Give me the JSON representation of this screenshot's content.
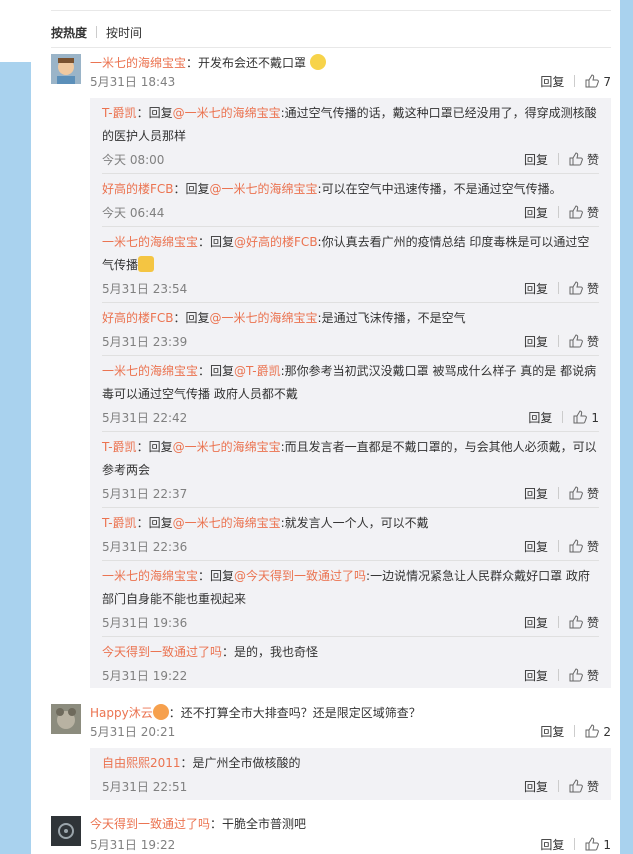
{
  "sort": {
    "hot": "按热度",
    "time": "按时间"
  },
  "labels": {
    "reply": "回复",
    "like": "赞"
  },
  "colors": {
    "link": "#eb7350",
    "accent_bg": "#a9d2ee",
    "reply_bg": "#f2f2f5"
  },
  "comments": [
    {
      "user": "一米七的海绵宝宝",
      "text": "：开发布会还不戴口罩 ",
      "time": "5月31日 18:43",
      "likes": "7",
      "replies": [
        {
          "user": "T-爵凯",
          "pre": "：回复",
          "at": "@一米七的海绵宝宝",
          "text": ":通过空气传播的话，戴这种口罩已经没用了，得穿成测核酸的医护人员那样",
          "time": "今天 08:00",
          "likes": "赞"
        },
        {
          "user": "好高的楼FCB",
          "pre": "：回复",
          "at": "@一米七的海绵宝宝",
          "text": ":可以在空气中迅速传播，不是通过空气传播。",
          "time": "今天 06:44",
          "likes": "赞"
        },
        {
          "user": "一米七的海绵宝宝",
          "pre": "：回复",
          "at": "@好高的楼FCB",
          "text": ":你认真去看广州的疫情总结 印度毒株是可以通过空气传播",
          "time": "5月31日 23:54",
          "likes": "赞"
        },
        {
          "user": "好高的楼FCB",
          "pre": "：回复",
          "at": "@一米七的海绵宝宝",
          "text": ":是通过飞沫传播，不是空气",
          "time": "5月31日 23:39",
          "likes": "赞"
        },
        {
          "user": "一米七的海绵宝宝",
          "pre": "：回复",
          "at": "@T-爵凯",
          "text": ":那你参考当初武汉没戴口罩 被骂成什么样子 真的是 都说病毒可以通过空气传播  政府人员都不戴",
          "time": "5月31日 22:42",
          "likes": "1"
        },
        {
          "user": "T-爵凯",
          "pre": "：回复",
          "at": "@一米七的海绵宝宝",
          "text": ":而且发言者一直都是不戴口罩的，与会其他人必须戴，可以参考两会",
          "time": "5月31日 22:37",
          "likes": "赞"
        },
        {
          "user": "T-爵凯",
          "pre": "：回复",
          "at": "@一米七的海绵宝宝",
          "text": ":就发言人一个人，可以不戴",
          "time": "5月31日 22:36",
          "likes": "赞"
        },
        {
          "user": "一米七的海绵宝宝",
          "pre": "：回复",
          "at": "@今天得到一致通过了吗",
          "text": ":一边说情况紧急让人民群众戴好口罩 政府部门自身能不能也重视起来",
          "time": "5月31日 19:36",
          "likes": "赞"
        },
        {
          "user": "今天得到一致通过了吗",
          "pre": "",
          "at": "",
          "text": "：是的，我也奇怪",
          "time": "5月31日 19:22",
          "likes": "赞"
        }
      ]
    },
    {
      "user": "Happy沐云",
      "text": "：还不打算全市大排查吗？还是限定区域筛查？",
      "time": "5月31日 20:21",
      "likes": "2",
      "replies": [
        {
          "user": "自由熙熙2011",
          "pre": "",
          "at": "",
          "text": "：是广州全市做核酸的",
          "time": "5月31日 22:51",
          "likes": "赞"
        }
      ]
    },
    {
      "user": "今天得到一致通过了吗",
      "text": "：干脆全市普测吧",
      "time": "5月31日 19:22",
      "likes": "1",
      "replies": []
    }
  ]
}
